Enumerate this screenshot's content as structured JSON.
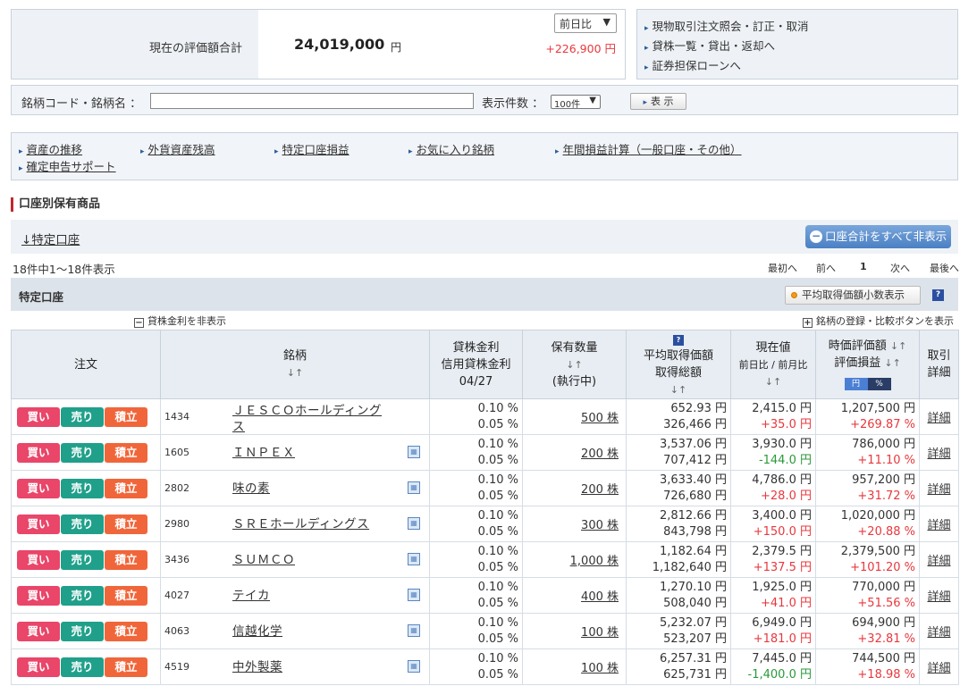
{
  "summary": {
    "label": "現在の評価額合計",
    "value": "24,019,000",
    "unit": "円",
    "period_select": "前日比",
    "change": "+226,900 円"
  },
  "quick_links": [
    "現物取引注文照会・訂正・取消",
    "貸株一覧・貸出・返却へ",
    "証券担保ローンへ"
  ],
  "search": {
    "code_label": "銘柄コード・銘柄名 ：",
    "code_value": "",
    "count_label": "表示件数 ：",
    "count_select": "100件",
    "submit": "表 示"
  },
  "nav_links": [
    "資産の推移",
    "外貨資産残高",
    "特定口座損益",
    "お気に入り銘柄",
    "年間損益計算（一般口座・その他）",
    "確定申告サポート"
  ],
  "section_title": "口座別保有商品",
  "account_link": "↓特定口座",
  "hide_all_button": "口座合計をすべて非表示",
  "result_count": "18件中1〜18件表示",
  "pager": {
    "first": "最初へ",
    "prev": "前へ",
    "page": "1",
    "next": "次へ",
    "last": "最後へ"
  },
  "table_title": "特定口座",
  "avg_button": "平均取得価額小数表示",
  "toggle_left": "貸株金利を非表示",
  "toggle_right": "銘柄の登録・比較ボタンを表示",
  "headers": {
    "order": "注文",
    "name": "銘柄",
    "rate1": "貸株金利",
    "rate2": "信用貸株金利",
    "rate_date": "04/27",
    "qty1": "保有数量",
    "qty2": "(執行中)",
    "avg1": "平均取得価額",
    "avg2": "取得総額",
    "price1": "現在値",
    "price2": "前日比 / 前月比",
    "eval1": "時価評価額",
    "eval2": "評価損益",
    "yen": "円",
    "pct": "%",
    "detail1": "取引",
    "detail2": "詳細",
    "help": "?"
  },
  "buttons": {
    "buy": "買い",
    "sell": "売り",
    "accum": "積立"
  },
  "rows": [
    {
      "code": "1434",
      "name": "ＪＥＳＣＯホールディングス",
      "rate1": "0.10 %",
      "rate2": "0.05 %",
      "qty": "500 株",
      "avg": "652.93 円",
      "total": "326,466 円",
      "price": "2,415.0 円",
      "diff": "+35.0 円",
      "diff_color": "#e8383d",
      "eval": "1,207,500 円",
      "pl": "+269.87 %",
      "pl_color": "#e8383d",
      "detail": "詳細",
      "cal": false
    },
    {
      "code": "1605",
      "name": "ＩＮＰＥＸ",
      "rate1": "0.10 %",
      "rate2": "0.05 %",
      "qty": "200 株",
      "avg": "3,537.06 円",
      "total": "707,412 円",
      "price": "3,930.0 円",
      "diff": "-144.0 円",
      "diff_color": "#2a9a3a",
      "eval": "786,000 円",
      "pl": "+11.10 %",
      "pl_color": "#e8383d",
      "detail": "詳細",
      "cal": true
    },
    {
      "code": "2802",
      "name": "味の素",
      "rate1": "0.10 %",
      "rate2": "0.05 %",
      "qty": "200 株",
      "avg": "3,633.40 円",
      "total": "726,680 円",
      "price": "4,786.0 円",
      "diff": "+28.0 円",
      "diff_color": "#e8383d",
      "eval": "957,200 円",
      "pl": "+31.72 %",
      "pl_color": "#e8383d",
      "detail": "詳細",
      "cal": true
    },
    {
      "code": "2980",
      "name": "ＳＲＥホールディングス",
      "rate1": "0.10 %",
      "rate2": "0.05 %",
      "qty": "300 株",
      "avg": "2,812.66 円",
      "total": "843,798 円",
      "price": "3,400.0 円",
      "diff": "+150.0 円",
      "diff_color": "#e8383d",
      "eval": "1,020,000 円",
      "pl": "+20.88 %",
      "pl_color": "#e8383d",
      "detail": "詳細",
      "cal": true
    },
    {
      "code": "3436",
      "name": "ＳＵＭＣＯ",
      "rate1": "0.10 %",
      "rate2": "0.05 %",
      "qty": "1,000 株",
      "avg": "1,182.64 円",
      "total": "1,182,640 円",
      "price": "2,379.5 円",
      "diff": "+137.5 円",
      "diff_color": "#e8383d",
      "eval": "2,379,500 円",
      "pl": "+101.20 %",
      "pl_color": "#e8383d",
      "detail": "詳細",
      "cal": true
    },
    {
      "code": "4027",
      "name": "テイカ",
      "rate1": "0.10 %",
      "rate2": "0.05 %",
      "qty": "400 株",
      "avg": "1,270.10 円",
      "total": "508,040 円",
      "price": "1,925.0 円",
      "diff": "+41.0 円",
      "diff_color": "#e8383d",
      "eval": "770,000 円",
      "pl": "+51.56 %",
      "pl_color": "#e8383d",
      "detail": "詳細",
      "cal": true
    },
    {
      "code": "4063",
      "name": "信越化学",
      "rate1": "0.10 %",
      "rate2": "0.05 %",
      "qty": "100 株",
      "avg": "5,232.07 円",
      "total": "523,207 円",
      "price": "6,949.0 円",
      "diff": "+181.0 円",
      "diff_color": "#e8383d",
      "eval": "694,900 円",
      "pl": "+32.81 %",
      "pl_color": "#e8383d",
      "detail": "詳細",
      "cal": true
    },
    {
      "code": "4519",
      "name": "中外製薬",
      "rate1": "0.10 %",
      "rate2": "0.05 %",
      "qty": "100 株",
      "avg": "6,257.31 円",
      "total": "625,731 円",
      "price": "7,445.0 円",
      "diff": "-1,400.0 円",
      "diff_color": "#2a9a3a",
      "eval": "744,500 円",
      "pl": "+18.98 %",
      "pl_color": "#e8383d",
      "detail": "詳細",
      "cal": true
    }
  ]
}
